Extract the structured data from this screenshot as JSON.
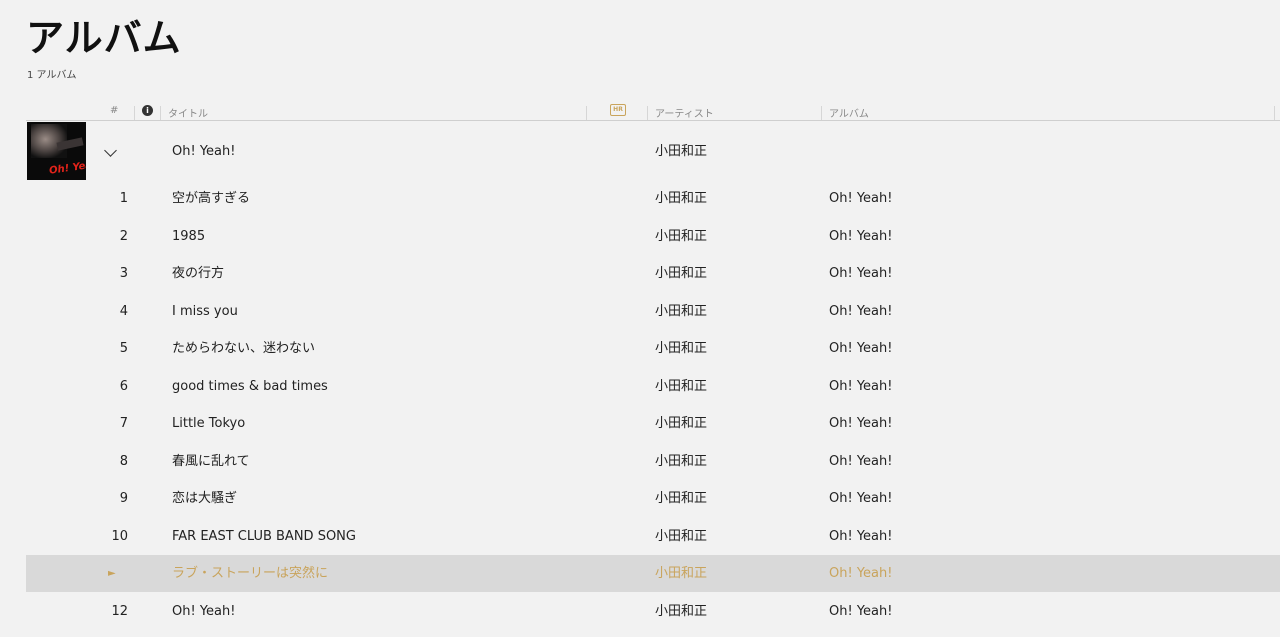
{
  "page": {
    "title": "アルバム",
    "subtitle": "1 アルバム"
  },
  "columns": {
    "number": "#",
    "info_icon": "i",
    "title": "タイトル",
    "hr_icon": "HR",
    "artist": "アーティスト",
    "album": "アルバム"
  },
  "group": {
    "title": "Oh! Yeah!",
    "artist": "小田和正",
    "cover_text": "Oh! Yeah!"
  },
  "tracks": [
    {
      "num": "1",
      "title": "空が高すぎる",
      "artist": "小田和正",
      "album": "Oh! Yeah!"
    },
    {
      "num": "2",
      "title": "1985",
      "artist": "小田和正",
      "album": "Oh! Yeah!"
    },
    {
      "num": "3",
      "title": "夜の行方",
      "artist": "小田和正",
      "album": "Oh! Yeah!"
    },
    {
      "num": "4",
      "title": "I miss you",
      "artist": "小田和正",
      "album": "Oh! Yeah!"
    },
    {
      "num": "5",
      "title": "ためらわない、迷わない",
      "artist": "小田和正",
      "album": "Oh! Yeah!"
    },
    {
      "num": "6",
      "title": "good times & bad times",
      "artist": "小田和正",
      "album": "Oh! Yeah!"
    },
    {
      "num": "7",
      "title": "Little Tokyo",
      "artist": "小田和正",
      "album": "Oh! Yeah!"
    },
    {
      "num": "8",
      "title": "春風に乱れて",
      "artist": "小田和正",
      "album": "Oh! Yeah!"
    },
    {
      "num": "9",
      "title": "恋は大騒ぎ",
      "artist": "小田和正",
      "album": "Oh! Yeah!"
    },
    {
      "num": "10",
      "title": "FAR EAST CLUB BAND SONG",
      "artist": "小田和正",
      "album": "Oh! Yeah!"
    },
    {
      "num": "►",
      "title": "ラブ・ストーリーは突然に",
      "artist": "小田和正",
      "album": "Oh! Yeah!",
      "playing": true
    },
    {
      "num": "12",
      "title": "Oh! Yeah!",
      "artist": "小田和正",
      "album": "Oh! Yeah!"
    }
  ],
  "colors": {
    "background": "#f2f2f2",
    "accent_playing": "#c9a45c",
    "playing_row_bg": "#d9d9d9"
  }
}
